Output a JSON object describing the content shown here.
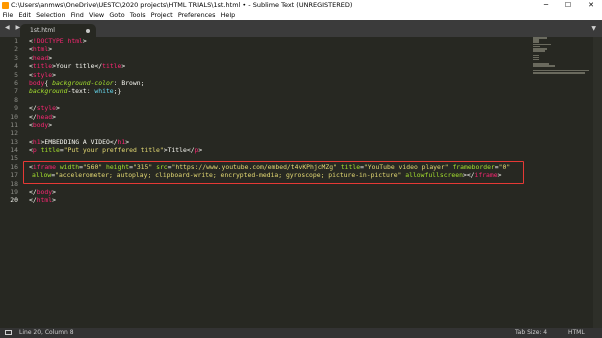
{
  "window": {
    "title": "C:\\Users\\anmws\\OneDrive\\UESTC\\2020 projects\\HTML TRIALS\\1st.html • - Sublime Text (UNREGISTERED)",
    "controls": {
      "minimize": "─",
      "maximize": "☐",
      "close": "✕"
    }
  },
  "menu": [
    "File",
    "Edit",
    "Selection",
    "Find",
    "View",
    "Goto",
    "Tools",
    "Project",
    "Preferences",
    "Help"
  ],
  "tabs": {
    "nav": "◀ ▶",
    "active": "1st.html",
    "dropdown": "▼"
  },
  "editor": {
    "line_numbers": [
      "1",
      "2",
      "3",
      "4",
      "5",
      "6",
      "7",
      "8",
      "9",
      "10",
      "11",
      "12",
      "13",
      "14",
      "15",
      "16",
      "17",
      "18",
      "19",
      "20"
    ],
    "current_line": "20",
    "lines": {
      "l1": {
        "a": "<",
        "b": "!DOCTYPE",
        "c": " ",
        "d": "html",
        "e": ">"
      },
      "l2": {
        "a": "<",
        "b": "html",
        "c": ">"
      },
      "l3": {
        "a": "<",
        "b": "head",
        "c": ">"
      },
      "l4": {
        "a": "<",
        "b": "title",
        "c": ">",
        "d": "Your title",
        "e": "</",
        "f": "title",
        "g": ">"
      },
      "l5": {
        "a": "<",
        "b": "style",
        "c": ">"
      },
      "l6": {
        "a": "body",
        "b": "{ ",
        "c": "background-color",
        "d": ": ",
        "e": "Brown",
        "f": ";"
      },
      "l7": {
        "a": "background",
        "b": "-text: ",
        "c": "white",
        "d": ";}"
      },
      "l9": {
        "a": "</",
        "b": "style",
        "c": ">"
      },
      "l10": {
        "a": "</",
        "b": "head",
        "c": ">"
      },
      "l11": {
        "a": "<",
        "b": "body",
        "c": ">"
      },
      "l13": {
        "a": "<",
        "b": "h1",
        "c": ">",
        "d": "EMBEDDING A VIDEO",
        "e": "</",
        "f": "h1",
        "g": ">"
      },
      "l14": {
        "a": "<",
        "b": "p",
        "c": " ",
        "d": "title",
        "e": "=",
        "f": "\"Put your preffered title\"",
        "g": ">",
        "h": "Title",
        "i": "</",
        "j": "p",
        "k": ">"
      },
      "l16": {
        "a": "<",
        "b": "iframe",
        "c": " ",
        "d": "width",
        "e": "=",
        "f": "\"560\"",
        "g": " ",
        "h": "height",
        "i": "=",
        "j": "\"315\"",
        "k": " ",
        "l": "src",
        "m": "=",
        "n": "\"https://www.youtube.com/embed/t4vKPhjcMZg\"",
        "o": " ",
        "p": "title",
        "q": "=",
        "r": "\"YouTube video player\"",
        "s": " ",
        "t": "frameborder",
        "u": "=",
        "v": "\"0\""
      },
      "l17": {
        "a": "allow",
        "b": "=",
        "c": "\"accelerometer; autoplay; clipboard-write; encrypted-media; gyroscope; picture-in-picture\"",
        "d": " ",
        "e": "allowfullscreen",
        "f": "></",
        "g": "iframe",
        "h": ">"
      },
      "l19": {
        "a": "</",
        "b": "body",
        "c": ">"
      },
      "l20": {
        "a": "</",
        "b": "html",
        "c": ">"
      }
    }
  },
  "status": {
    "position": "Line 20, Column 8",
    "tab_size": "Tab Size: 4",
    "syntax": "HTML"
  },
  "colors": {
    "editor_bg": "#272822",
    "tag": "#f92672",
    "attribute": "#a6e22e",
    "string": "#e6db74",
    "highlight_box": "#e53935"
  }
}
